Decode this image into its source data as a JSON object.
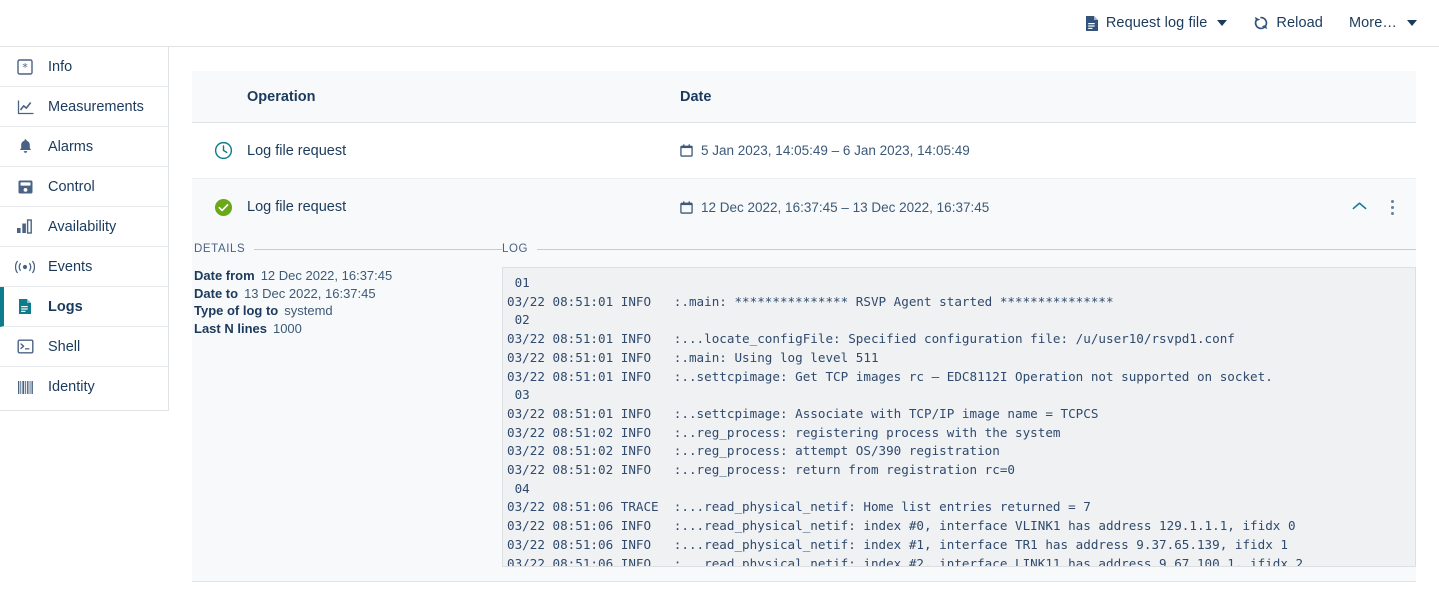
{
  "toolbar": {
    "buttons": [
      {
        "label": "Request log file",
        "icon": "file-icon",
        "has_caret": true
      },
      {
        "label": "Reload",
        "icon": "reload-icon",
        "has_caret": false
      },
      {
        "label": "More…",
        "icon": "",
        "has_caret": true
      }
    ]
  },
  "sidebar": {
    "items": [
      {
        "label": "Info",
        "icon": "info-asterisk-icon",
        "active": false
      },
      {
        "label": "Measurements",
        "icon": "chart-line-icon",
        "active": false
      },
      {
        "label": "Alarms",
        "icon": "bell-icon",
        "active": false
      },
      {
        "label": "Control",
        "icon": "control-panel-icon",
        "active": false
      },
      {
        "label": "Availability",
        "icon": "bar-chart-icon",
        "active": false
      },
      {
        "label": "Events",
        "icon": "broadcast-icon",
        "active": false
      },
      {
        "label": "Logs",
        "icon": "document-icon",
        "active": true
      },
      {
        "label": "Shell",
        "icon": "terminal-icon",
        "active": false
      },
      {
        "label": "Identity",
        "icon": "barcode-icon",
        "active": false
      }
    ]
  },
  "table": {
    "columns": {
      "operation": "Operation",
      "date": "Date"
    },
    "rows": [
      {
        "status_icon": "clock-icon",
        "status": "pending",
        "operation": "Log file request",
        "date": "5 Jan 2023, 14:05:49 – 6 Jan 2023, 14:05:49",
        "date_icon": "calendar-icon",
        "expanded": false
      },
      {
        "status_icon": "check-circle-icon",
        "status": "success",
        "operation": "Log file request",
        "date": "12 Dec 2022, 16:37:45 – 13 Dec 2022, 16:37:45",
        "date_icon": "calendar-icon",
        "expanded": true
      }
    ]
  },
  "detail": {
    "details_heading": "DETAILS",
    "log_heading": "LOG",
    "fields": [
      {
        "key": "Date from",
        "value": "12 Dec 2022, 16:37:45"
      },
      {
        "key": "Date to",
        "value": "13 Dec 2022, 16:37:45"
      },
      {
        "key": "Type of log to",
        "value": "systemd"
      },
      {
        "key": "Last N lines",
        "value": "1000"
      }
    ],
    "log_lines": [
      " 01",
      "03/22 08:51:01 INFO   :.main: *************** RSVP Agent started ***************",
      " 02",
      "03/22 08:51:01 INFO   :...locate_configFile: Specified configuration file: /u/user10/rsvpd1.conf",
      "03/22 08:51:01 INFO   :.main: Using log level 511",
      "03/22 08:51:01 INFO   :..settcpimage: Get TCP images rc – EDC8112I Operation not supported on socket.",
      " 03",
      "03/22 08:51:01 INFO   :..settcpimage: Associate with TCP/IP image name = TCPCS",
      "03/22 08:51:02 INFO   :..reg_process: registering process with the system",
      "03/22 08:51:02 INFO   :..reg_process: attempt OS/390 registration",
      "03/22 08:51:02 INFO   :..reg_process: return from registration rc=0",
      " 04",
      "03/22 08:51:06 TRACE  :...read_physical_netif: Home list entries returned = 7",
      "03/22 08:51:06 INFO   :...read_physical_netif: index #0, interface VLINK1 has address 129.1.1.1, ifidx 0",
      "03/22 08:51:06 INFO   :...read_physical_netif: index #1, interface TR1 has address 9.37.65.139, ifidx 1",
      "03/22 08:51:06 INFO   :...read_physical_netif: index #2, interface LINK11 has address 9.67.100.1, ifidx 2"
    ]
  },
  "colors": {
    "accent_teal": "#0e7c8c",
    "text_navy": "#1b3a5c",
    "success_green": "#6aa818",
    "panel_bg": "#f8f9fa",
    "log_bg": "#f0f1f3"
  }
}
